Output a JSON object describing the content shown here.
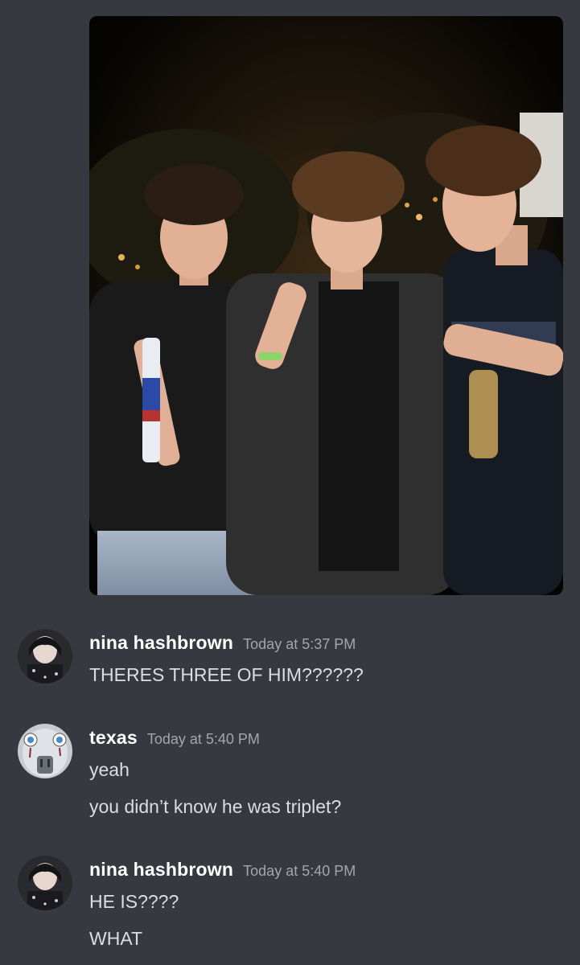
{
  "attachment": {
    "type": "photo",
    "subject": "three-friends-night-photo"
  },
  "messages": [
    {
      "username": "nina hashbrown",
      "timestamp": "Today at 5:37 PM",
      "avatar": "dark-haired-figure-avatar",
      "lines": [
        "THERES THREE OF HIM??????"
      ]
    },
    {
      "username": "texas",
      "timestamp": "Today at 5:40 PM",
      "avatar": "pale-cartoon-face-avatar",
      "lines": [
        "yeah",
        "you didn’t know he was triplet?"
      ]
    },
    {
      "username": "nina hashbrown",
      "timestamp": "Today at 5:40 PM",
      "avatar": "dark-haired-figure-avatar",
      "lines": [
        "HE IS????",
        "WHAT"
      ]
    }
  ],
  "colors": {
    "background": "#36393f",
    "username": "#ffffff",
    "timestamp": "#a3a6aa",
    "message_text": "#dcddde"
  }
}
